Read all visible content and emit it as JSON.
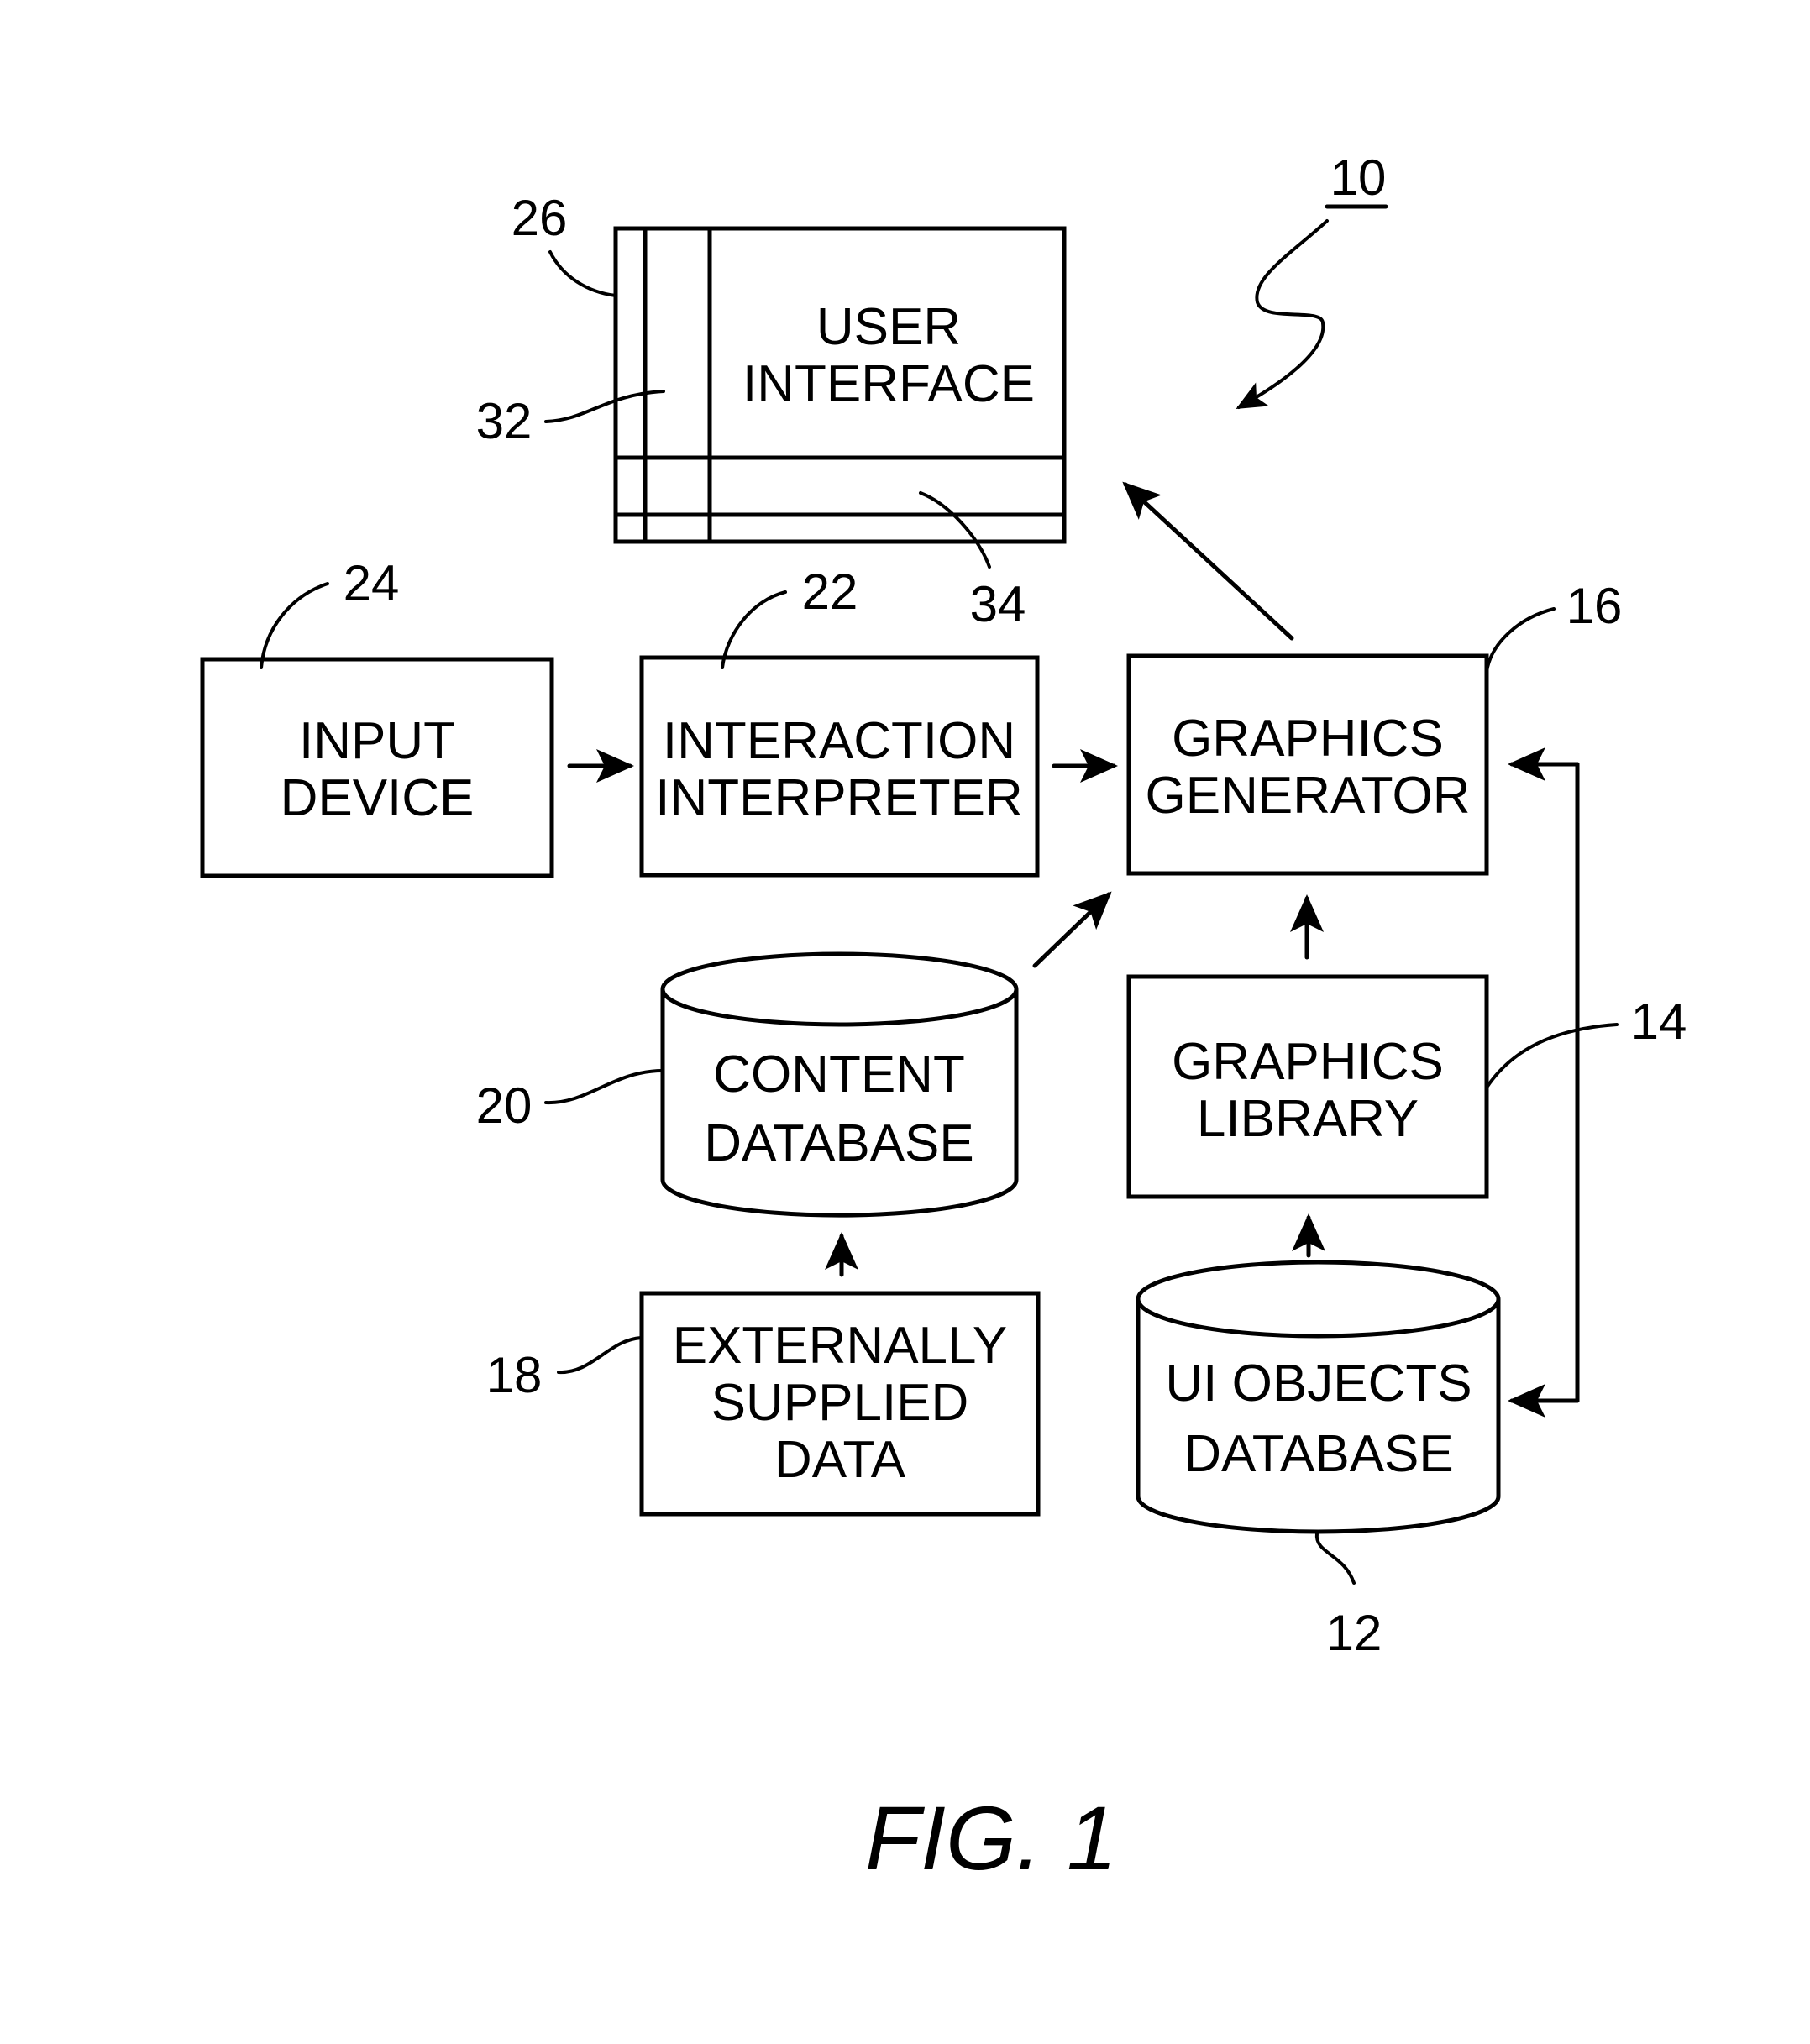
{
  "figure": {
    "caption": "FIG. 1",
    "system_ref": "10"
  },
  "components": {
    "user_interface": {
      "ref": "26",
      "lines": [
        "USER",
        "INTERFACE"
      ],
      "sub_refs": {
        "side_panel": "32",
        "bottom_panel": "34"
      }
    },
    "input_device": {
      "ref": "24",
      "lines": [
        "INPUT",
        "DEVICE"
      ]
    },
    "interaction_interpreter": {
      "ref": "22",
      "lines": [
        "INTERACTION",
        "INTERPRETER"
      ]
    },
    "graphics_generator": {
      "ref": "16",
      "lines": [
        "GRAPHICS",
        "GENERATOR"
      ]
    },
    "graphics_library": {
      "ref": "14",
      "lines": [
        "GRAPHICS",
        "LIBRARY"
      ]
    },
    "content_database": {
      "ref": "20",
      "lines": [
        "CONTENT",
        "DATABASE"
      ]
    },
    "externally_supplied_data": {
      "ref": "18",
      "lines": [
        "EXTERNALLY",
        "SUPPLIED",
        "DATA"
      ]
    },
    "ui_objects_database": {
      "ref": "12",
      "lines": [
        "UI OBJECTS",
        "DATABASE"
      ]
    }
  },
  "connections": [
    {
      "from": "input_device",
      "to": "interaction_interpreter"
    },
    {
      "from": "interaction_interpreter",
      "to": "graphics_generator"
    },
    {
      "from": "content_database",
      "to": "graphics_generator"
    },
    {
      "from": "graphics_library",
      "to": "graphics_generator"
    },
    {
      "from": "ui_objects_database",
      "to": "graphics_library"
    },
    {
      "from": "externally_supplied_data",
      "to": "content_database"
    },
    {
      "from": "graphics_generator",
      "to": "user_interface"
    },
    {
      "from": "graphics_generator",
      "to": "ui_objects_database",
      "bidirectional": true
    }
  ]
}
